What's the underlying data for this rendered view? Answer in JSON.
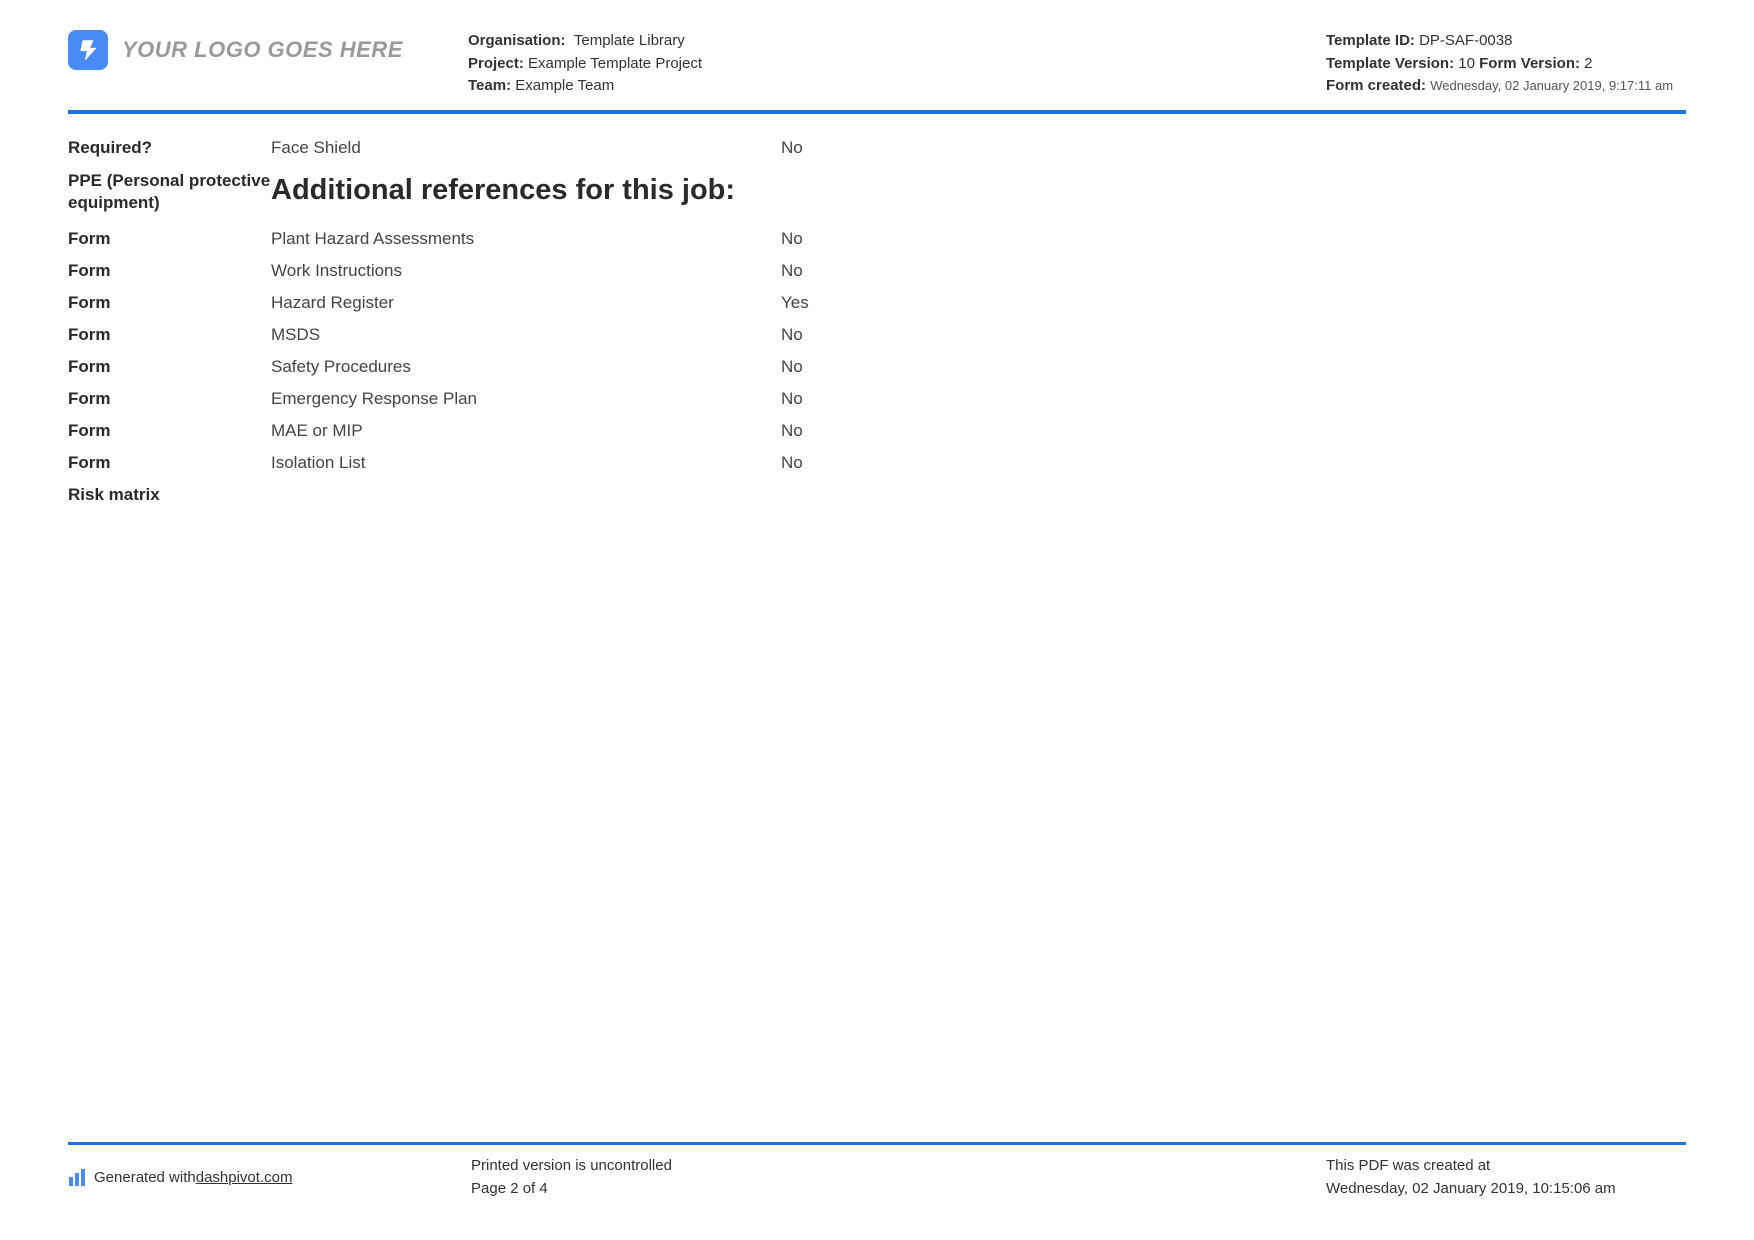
{
  "header": {
    "logo_text": "YOUR LOGO GOES HERE",
    "organisation_label": "Organisation:",
    "organisation_value": "Template Library",
    "project_label": "Project:",
    "project_value": "Example Template Project",
    "team_label": "Team:",
    "team_value": "Example Team",
    "template_id_label": "Template ID:",
    "template_id_value": "DP-SAF-0038",
    "template_version_label": "Template Version:",
    "template_version_value": "10",
    "form_version_label": "Form Version:",
    "form_version_value": "2",
    "form_created_label": "Form created:",
    "form_created_value": "Wednesday, 02 January 2019, 9:17:11 am"
  },
  "top_row": {
    "label": "Required?",
    "item": "Face Shield",
    "value": "No"
  },
  "ppe_label": "PPE (Personal protective equipment)",
  "section_heading": "Additional references for this job:",
  "rows": [
    {
      "label": "Form",
      "item": "Plant Hazard Assessments",
      "value": "No"
    },
    {
      "label": "Form",
      "item": "Work Instructions",
      "value": "No"
    },
    {
      "label": "Form",
      "item": "Hazard Register",
      "value": "Yes"
    },
    {
      "label": "Form",
      "item": "MSDS",
      "value": "No"
    },
    {
      "label": "Form",
      "item": "Safety Procedures",
      "value": "No"
    },
    {
      "label": "Form",
      "item": "Emergency Response Plan",
      "value": "No"
    },
    {
      "label": "Form",
      "item": "MAE or MIP",
      "value": "No"
    },
    {
      "label": "Form",
      "item": "Isolation List",
      "value": "No"
    }
  ],
  "risk_matrix_label": "Risk matrix",
  "footer": {
    "generated_prefix": "Generated with ",
    "generated_link": "dashpivot.com",
    "uncontrolled": "Printed version is uncontrolled",
    "page_info": "Page 2 of 4",
    "created_label": "This PDF was created at",
    "created_value": "Wednesday, 02 January 2019, 10:15:06 am"
  }
}
